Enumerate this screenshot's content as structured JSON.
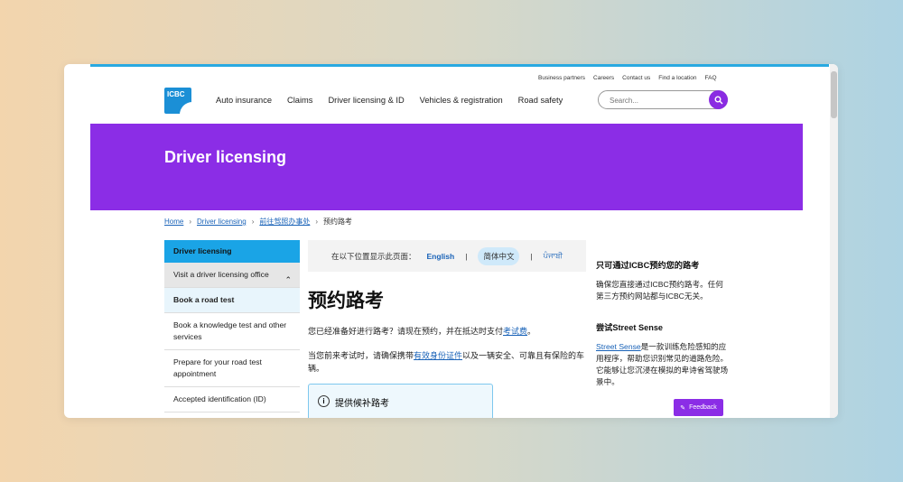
{
  "utility_links": [
    "Business partners",
    "Careers",
    "Contact us",
    "Find a location",
    "FAQ"
  ],
  "logo": {
    "text": "ICBC"
  },
  "nav": [
    "Auto insurance",
    "Claims",
    "Driver licensing & ID",
    "Vehicles & registration",
    "Road safety"
  ],
  "search": {
    "placeholder": "Search..."
  },
  "hero": {
    "title": "Driver licensing"
  },
  "breadcrumb": [
    "Home",
    "Driver licensing",
    "前往驾照办事处",
    "预约路考"
  ],
  "sidebar": {
    "header": "Driver licensing",
    "items": [
      "Visit a driver licensing office",
      "Book a road test",
      "Book a knowledge test and other services",
      "Prepare for your road test appointment",
      "Accepted identification (ID)"
    ]
  },
  "language_bar": {
    "label": "在以下位置显示此页面：",
    "english": "English",
    "chinese": "简体中文",
    "punjabi": "ਪੰਜਾਬੀ"
  },
  "main": {
    "title": "预约路考",
    "para1_prefix": "您已经准备好进行路考？请现在预约，并在抵达时支付",
    "para1_link": "考试费",
    "para1_suffix": "。",
    "para2_prefix": "当您前来考试时，请确保携带",
    "para2_link": "有效身份证件",
    "para2_suffix": "以及一辆安全、可靠且有保险的车辆。",
    "info_title": "提供候补路考"
  },
  "right": {
    "head1": "只可通过ICBC预约您的路考",
    "para1": "确保您直接通过ICBC预约路考。任何第三方预约网站都与ICBC无关。",
    "head2": "尝试Street Sense",
    "para2_link": "Street Sense",
    "para2_rest": "是一款训练危险感知的应用程序，帮助您识别常见的道路危险。它能够让您沉浸在模拟的卑诗省驾驶场景中。"
  },
  "feedback": {
    "label": "Feedback"
  },
  "colors": {
    "brand_purple": "#8b2de6",
    "brand_blue": "#1b8fd6",
    "link_blue": "#1a63b8"
  }
}
